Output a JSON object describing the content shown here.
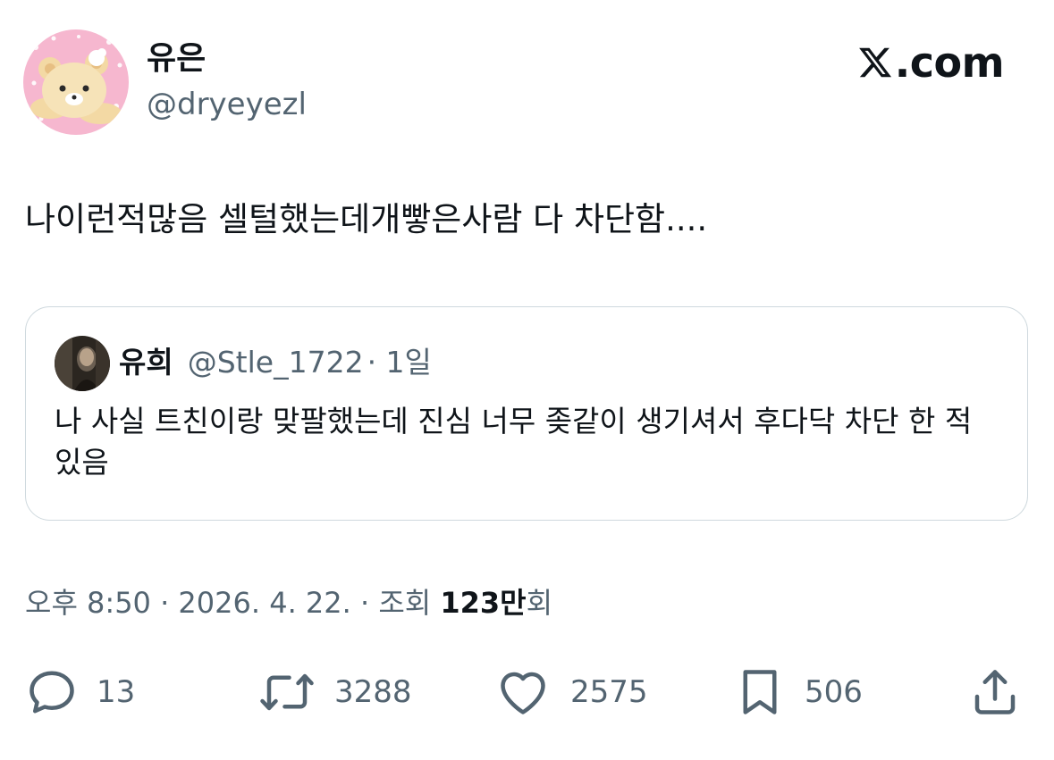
{
  "author": {
    "display_name": "유은",
    "handle": "@dryeyezl",
    "avatar_icon": "bear-avatar-icon"
  },
  "brand": {
    "label": ".com",
    "icon": "x-logo-icon"
  },
  "tweet": {
    "text": "나이런적많음 셀털했는데개빻은사람 다 차단함...."
  },
  "quote": {
    "display_name": "유희",
    "handle": "@Stle_1722",
    "age": "· 1일",
    "text": "나 사실 트친이랑 맞팔했는데 진심 너무 좆같이 생기셔서 후다닥 차단 한 적 있음",
    "avatar_icon": "photo-avatar-icon"
  },
  "meta": {
    "time": "오후 8:50 · 2026. 4. 22. · 조회 ",
    "views_count": "123만",
    "views_suffix": "회"
  },
  "actions": {
    "replies": "13",
    "retweets": "3288",
    "likes": "2575",
    "bookmarks": "506"
  },
  "colors": {
    "text_primary": "#0f1419",
    "text_secondary": "#536471",
    "border": "#cfd9de"
  }
}
